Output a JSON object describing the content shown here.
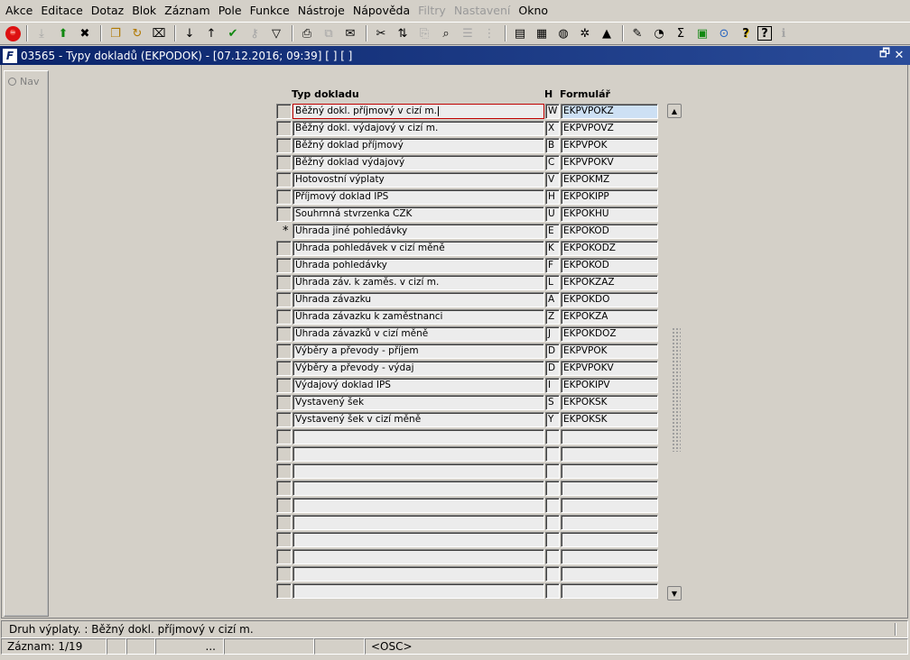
{
  "menu": [
    {
      "label": "Akce",
      "disabled": false
    },
    {
      "label": "Editace",
      "disabled": false
    },
    {
      "label": "Dotaz",
      "disabled": false
    },
    {
      "label": "Blok",
      "disabled": false
    },
    {
      "label": "Záznam",
      "disabled": false
    },
    {
      "label": "Pole",
      "disabled": false
    },
    {
      "label": "Funkce",
      "disabled": false
    },
    {
      "label": "Nástroje",
      "disabled": false
    },
    {
      "label": "Nápověda",
      "disabled": false
    },
    {
      "label": "Filtry",
      "disabled": true
    },
    {
      "label": "Nastavení",
      "disabled": true
    },
    {
      "label": "Okno",
      "disabled": false
    }
  ],
  "toolbar": [
    [
      "exit-icon",
      "⛔",
      false
    ],
    "sep",
    [
      "insert-record-icon",
      "⤓",
      true
    ],
    [
      "save-green-icon",
      "⬆",
      false
    ],
    [
      "delete-record-icon",
      "✖",
      false
    ],
    "sep",
    [
      "duplicate-icon",
      "❐",
      false
    ],
    [
      "refresh-icon",
      "↻",
      false
    ],
    [
      "clear-icon",
      "⌧",
      false
    ],
    "sep",
    [
      "sort-asc-icon",
      "↓",
      false
    ],
    [
      "sort-desc-icon",
      "↑",
      false
    ],
    [
      "check-icon",
      "✔",
      false
    ],
    [
      "key-icon",
      "⚷",
      true
    ],
    [
      "filter-icon",
      "▽",
      false
    ],
    "sep",
    [
      "print-icon",
      "⎙",
      false
    ],
    [
      "print-preview-icon",
      "⧉",
      true
    ],
    [
      "mail-icon",
      "✉",
      false
    ],
    "sep",
    [
      "cut-icon",
      "✂",
      false
    ],
    [
      "copy-icon",
      "⇅",
      false
    ],
    [
      "paste-icon",
      "⎘",
      true
    ],
    [
      "find-icon",
      "⌕",
      false
    ],
    [
      "list-icon",
      "☰",
      true
    ],
    [
      "tree-icon",
      "⋮",
      true
    ],
    "sep",
    [
      "form-icon",
      "▤",
      false
    ],
    [
      "calculator-icon",
      "▦",
      false
    ],
    [
      "globe-icon",
      "◍",
      false
    ],
    [
      "settings-icon",
      "✲",
      false
    ],
    [
      "mountain-icon",
      "▲",
      false
    ],
    "sep",
    [
      "chart-icon",
      "✎",
      false
    ],
    [
      "clock-icon",
      "◔",
      false
    ],
    [
      "sum-icon",
      "Σ",
      false
    ],
    [
      "excel-icon",
      "▣",
      false
    ],
    [
      "info-circle-icon",
      "⊙",
      false
    ],
    [
      "help-yellow-icon",
      "?",
      false
    ],
    [
      "help-icon",
      "?",
      false
    ],
    [
      "info-icon",
      "ℹ",
      true
    ]
  ],
  "window": {
    "title": "03565 - Typy dokladů (EKPODOK) - [07.12.2016; 09:39]  [ ] [ ]",
    "restore_icon": "🗗",
    "close_icon": "✕"
  },
  "nav": {
    "label": "Nav"
  },
  "table": {
    "headers": {
      "typ": "Typ dokladu",
      "h": "H",
      "form": "Formulář"
    },
    "rows": [
      {
        "typ": "Běžný dokl. příjmový v cizí m.",
        "h": "W",
        "form": "EKPVPOKZ",
        "marker": ""
      },
      {
        "typ": "Běžný dokl. výdajový v cizí m.",
        "h": "X",
        "form": "EKPVPOVZ",
        "marker": ""
      },
      {
        "typ": "Běžný doklad příjmový",
        "h": "B",
        "form": "EKPVPOK",
        "marker": ""
      },
      {
        "typ": "Běžný doklad výdajový",
        "h": "C",
        "form": "EKPVPOKV",
        "marker": ""
      },
      {
        "typ": "Hotovostní výplaty",
        "h": "V",
        "form": "EKPOKMZ",
        "marker": ""
      },
      {
        "typ": "Příjmový doklad IPS",
        "h": "H",
        "form": "EKPOKIPP",
        "marker": ""
      },
      {
        "typ": "Souhrnná stvrzenka CZK",
        "h": "U",
        "form": "EKPOKHU",
        "marker": ""
      },
      {
        "typ": "Úhrada jiné pohledávky",
        "h": "E",
        "form": "EKPOKOD",
        "marker": "*"
      },
      {
        "typ": "Úhrada pohledávek v cizí měně",
        "h": "K",
        "form": "EKPOKODZ",
        "marker": ""
      },
      {
        "typ": "Úhrada pohledávky",
        "h": "F",
        "form": "EKPOKOD",
        "marker": ""
      },
      {
        "typ": "Úhrada záv. k zaměs. v cizí m.",
        "h": "L",
        "form": "EKPOKZAZ",
        "marker": ""
      },
      {
        "typ": "Úhrada závazku",
        "h": "A",
        "form": "EKPOKDO",
        "marker": ""
      },
      {
        "typ": "Úhrada závazku k zaměstnanci",
        "h": "Z",
        "form": "EKPOKZA",
        "marker": ""
      },
      {
        "typ": "Úhrada závazků v cizí měně",
        "h": "J",
        "form": "EKPOKDOZ",
        "marker": ""
      },
      {
        "typ": "Výběry a převody - příjem",
        "h": "D",
        "form": "EKPVPOK",
        "marker": ""
      },
      {
        "typ": "Výběry a převody - výdaj",
        "h": "D",
        "form": "EKPVPOKV",
        "marker": ""
      },
      {
        "typ": "Výdajový doklad IPS",
        "h": "I",
        "form": "EKPOKIPV",
        "marker": ""
      },
      {
        "typ": "Vystavený šek",
        "h": "S",
        "form": "EKPOKSK",
        "marker": ""
      },
      {
        "typ": "Vystavený šek v cizí měně",
        "h": "Y",
        "form": "EKPOKSK",
        "marker": ""
      },
      {
        "typ": "",
        "h": "",
        "form": "",
        "marker": ""
      },
      {
        "typ": "",
        "h": "",
        "form": "",
        "marker": ""
      },
      {
        "typ": "",
        "h": "",
        "form": "",
        "marker": ""
      },
      {
        "typ": "",
        "h": "",
        "form": "",
        "marker": ""
      },
      {
        "typ": "",
        "h": "",
        "form": "",
        "marker": ""
      },
      {
        "typ": "",
        "h": "",
        "form": "",
        "marker": ""
      },
      {
        "typ": "",
        "h": "",
        "form": "",
        "marker": ""
      },
      {
        "typ": "",
        "h": "",
        "form": "",
        "marker": ""
      },
      {
        "typ": "",
        "h": "",
        "form": "",
        "marker": ""
      },
      {
        "typ": "",
        "h": "",
        "form": "",
        "marker": ""
      }
    ]
  },
  "scroll": {
    "up_icon": "▲",
    "down_icon": "▼"
  },
  "status": {
    "hint": "Druh výplaty. : Běžný dokl. příjmový v cizí m.",
    "record": "Záznam: 1/19",
    "cell_dots": "...",
    "mode": "<OSC>"
  },
  "colors": {
    "title_bar": "#0a246a",
    "active_border": "#c00000",
    "active_cell": "#cde0f4"
  }
}
